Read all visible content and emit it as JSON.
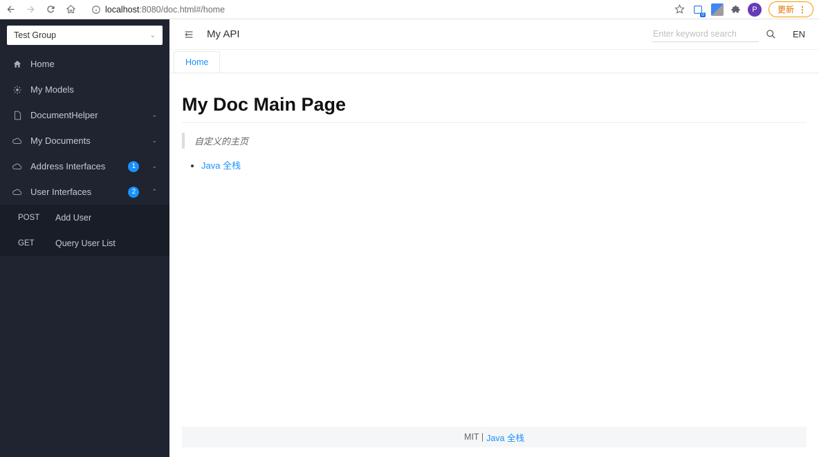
{
  "browser": {
    "host": "localhost",
    "port_path": ":8080/doc.html#/home",
    "avatar_letter": "P",
    "update_label": "更新",
    "translate_badge": "0"
  },
  "sidebar": {
    "group_selected": "Test Group",
    "items": [
      {
        "icon": "home",
        "label": "Home"
      },
      {
        "icon": "models",
        "label": "My Models"
      },
      {
        "icon": "doc",
        "label": "DocumentHelper",
        "expandable": true
      },
      {
        "icon": "cloud",
        "label": "My Documents",
        "expandable": true
      },
      {
        "icon": "cloud",
        "label": "Address Interfaces",
        "badge": "1",
        "expandable": true
      },
      {
        "icon": "cloud",
        "label": "User Interfaces",
        "badge": "2",
        "expanded": true
      }
    ],
    "submenu": [
      {
        "method": "POST",
        "label": "Add User"
      },
      {
        "method": "GET",
        "label": "Query User List"
      }
    ]
  },
  "header": {
    "title": "My API",
    "search_placeholder": "Enter keyword search",
    "lang": "EN"
  },
  "tabs": [
    {
      "label": "Home",
      "active": true
    }
  ],
  "doc": {
    "title": "My Doc Main Page",
    "quote": "自定义的主页",
    "link_label": "Java 全栈"
  },
  "footer": {
    "license": "MIT |",
    "link": "Java 全栈"
  }
}
